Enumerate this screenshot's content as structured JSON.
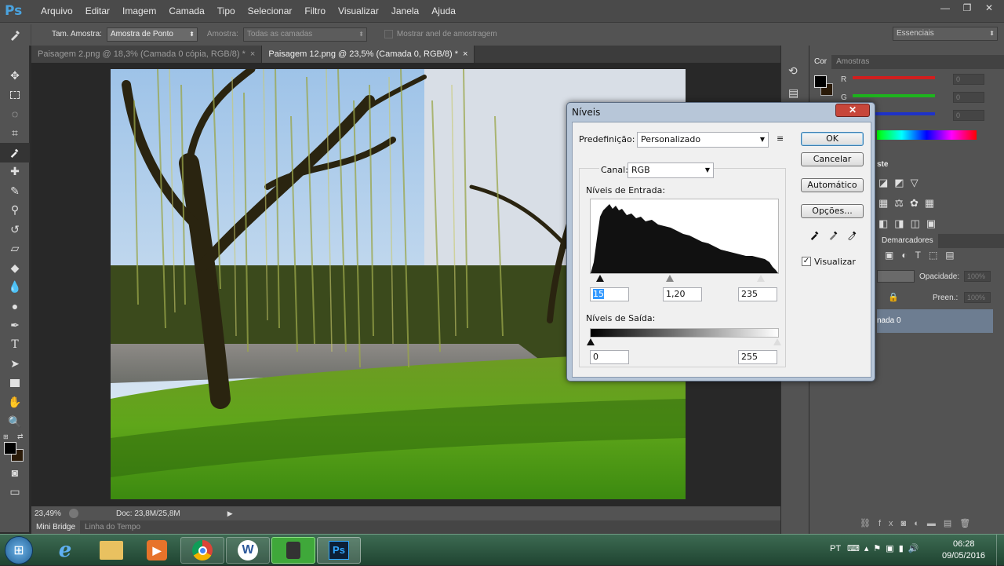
{
  "app": {
    "logo": "Ps",
    "menu": [
      "Arquivo",
      "Editar",
      "Imagem",
      "Camada",
      "Tipo",
      "Selecionar",
      "Filtro",
      "Visualizar",
      "Janela",
      "Ajuda"
    ],
    "window_controls": [
      "—",
      "❐",
      "✕"
    ]
  },
  "options_bar": {
    "sample_size_label": "Tam. Amostra:",
    "sample_size_value": "Amostra de Ponto",
    "sample_label": "Amostra:",
    "sample_value": "Todas as camadas",
    "show_ring_label": "Mostrar anel de amostragem",
    "workspace": "Essenciais"
  },
  "doc_tabs": [
    {
      "label": "Paisagem 2.png @ 18,3% (Camada 0 cópia, RGB/8) *",
      "close": "×"
    },
    {
      "label": "Paisagem 12.png @ 23,5% (Camada 0, RGB/8) *",
      "close": "×"
    }
  ],
  "status": {
    "zoom": "23,49%",
    "doc": "Doc: 23,8M/25,8M"
  },
  "bottom_tabs": [
    "Mini Bridge",
    "Linha do Tempo"
  ],
  "color_panel": {
    "tabs": [
      "Cor",
      "Amostras"
    ],
    "channels": [
      {
        "label": "R",
        "value": "0",
        "color": "#e02020"
      },
      {
        "label": "G",
        "value": "0",
        "color": "#20c020"
      },
      {
        "label": "B",
        "value": "0",
        "color": "#2040e0"
      }
    ]
  },
  "adjust_panel": {
    "title_fragment": "ste"
  },
  "layers_panel": {
    "tab": "Demarcadores",
    "opacity_label": "Opacidade:",
    "opacity_value": "100%",
    "fill_label": "Preen.:",
    "fill_value": "100%",
    "layer_name": "nada 0"
  },
  "levels_dialog": {
    "title": "Níveis",
    "close": "✕",
    "preset_label": "Predefinição:",
    "preset_value": "Personalizado",
    "channel_label": "Canal:",
    "channel_value": "RGB",
    "input_label": "Níveis de Entrada:",
    "input_black": "15",
    "input_gamma": "1,20",
    "input_white": "235",
    "output_label": "Níveis de Saída:",
    "output_black": "0",
    "output_white": "255",
    "buttons": {
      "ok": "OK",
      "cancel": "Cancelar",
      "auto": "Automático",
      "options": "Opções..."
    },
    "preview_label": "Visualizar",
    "preview_checked": true
  },
  "taskbar": {
    "lang": "PT",
    "time": "06:28",
    "date": "09/05/2016",
    "apps": [
      "start",
      "ie",
      "explorer",
      "media",
      "chrome",
      "word",
      "tool",
      "photoshop"
    ],
    "ps_label": "Ps",
    "word_label": "W"
  }
}
